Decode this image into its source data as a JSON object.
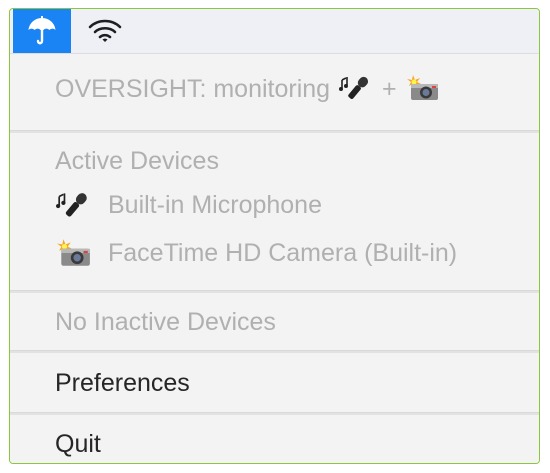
{
  "menubar": {
    "status_icon": "umbrella-icon",
    "wifi_icon": "wifi-icon",
    "accent_color": "#1a84f5"
  },
  "status": {
    "label": "OVERSIGHT: monitoring",
    "plus": "+",
    "mic_icon": "microphone-icon",
    "camera_icon": "camera-flash-icon"
  },
  "active_devices": {
    "header": "Active Devices",
    "items": [
      {
        "icon": "microphone-icon",
        "label": "Built-in Microphone"
      },
      {
        "icon": "camera-flash-icon",
        "label": "FaceTime HD Camera (Built-in)"
      }
    ]
  },
  "inactive_devices": {
    "header": "No Inactive Devices"
  },
  "menu": {
    "preferences_label": "Preferences",
    "quit_label": "Quit"
  }
}
